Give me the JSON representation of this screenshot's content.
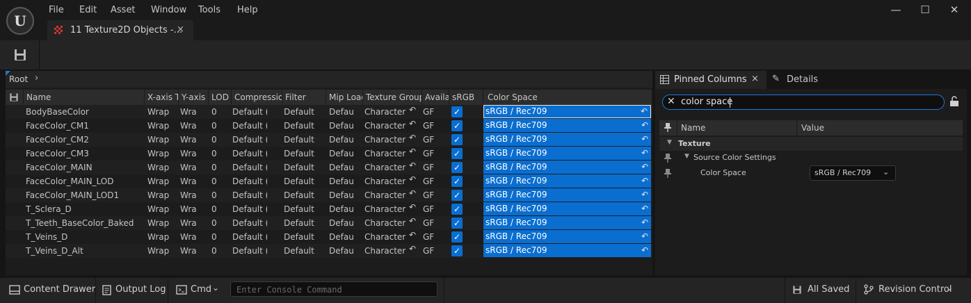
{
  "menu": [
    "File",
    "Edit",
    "Asset",
    "Window",
    "Tools",
    "Help"
  ],
  "tab": {
    "label": "11 Texture2D Objects -...",
    "close": "×"
  },
  "window_controls": {
    "minimize": "—",
    "maximize": "☐",
    "close": "✕"
  },
  "breadcrumb": {
    "root": "Root",
    "chevron": "›"
  },
  "columns": [
    "Name",
    "X-axis T",
    "Y-axis",
    "LOD",
    "Compression",
    "Filter",
    "Mip Load",
    "Texture Group",
    "Availa",
    "sRGB",
    "Color Space"
  ],
  "rows": [
    {
      "name": "BodyBaseColor",
      "x": "Wrap",
      "y": "Wra",
      "lod": "0",
      "compression": "Default (E",
      "filter": "Default",
      "mip": "Defau",
      "group": "Character",
      "avail": "GF",
      "srgb": true,
      "color_space": "sRGB / Rec709"
    },
    {
      "name": "FaceColor_CM1",
      "x": "Wrap",
      "y": "Wra",
      "lod": "0",
      "compression": "Default (E",
      "filter": "Default",
      "mip": "Defau",
      "group": "Character",
      "avail": "GF",
      "srgb": true,
      "color_space": "sRGB / Rec709"
    },
    {
      "name": "FaceColor_CM2",
      "x": "Wrap",
      "y": "Wra",
      "lod": "0",
      "compression": "Default (E",
      "filter": "Default",
      "mip": "Defau",
      "group": "Character",
      "avail": "GF",
      "srgb": true,
      "color_space": "sRGB / Rec709"
    },
    {
      "name": "FaceColor_CM3",
      "x": "Wrap",
      "y": "Wra",
      "lod": "0",
      "compression": "Default (E",
      "filter": "Default",
      "mip": "Defau",
      "group": "Character",
      "avail": "GF",
      "srgb": true,
      "color_space": "sRGB / Rec709"
    },
    {
      "name": "FaceColor_MAIN",
      "x": "Wrap",
      "y": "Wra",
      "lod": "0",
      "compression": "Default (E",
      "filter": "Default",
      "mip": "Defau",
      "group": "Character",
      "avail": "GF",
      "srgb": true,
      "color_space": "sRGB / Rec709"
    },
    {
      "name": "FaceColor_MAIN_LOD",
      "x": "Wrap",
      "y": "Wra",
      "lod": "0",
      "compression": "Default (E",
      "filter": "Default",
      "mip": "Defau",
      "group": "Character",
      "avail": "GF",
      "srgb": true,
      "color_space": "sRGB / Rec709"
    },
    {
      "name": "FaceColor_MAIN_LOD1",
      "x": "Wrap",
      "y": "Wra",
      "lod": "0",
      "compression": "Default (E",
      "filter": "Default",
      "mip": "Defau",
      "group": "Character",
      "avail": "GF",
      "srgb": true,
      "color_space": "sRGB / Rec709"
    },
    {
      "name": "T_Sclera_D",
      "x": "Wrap",
      "y": "Wra",
      "lod": "0",
      "compression": "Default (E",
      "filter": "Default",
      "mip": "Defau",
      "group": "Character",
      "avail": "GF",
      "srgb": true,
      "color_space": "sRGB / Rec709"
    },
    {
      "name": "T_Teeth_BaseColor_Baked",
      "x": "Wrap",
      "y": "Wra",
      "lod": "0",
      "compression": "Default (E",
      "filter": "Default",
      "mip": "Defau",
      "group": "Character",
      "avail": "GF",
      "srgb": true,
      "color_space": "sRGB / Rec709"
    },
    {
      "name": "T_Veins_D",
      "x": "Wrap",
      "y": "Wra",
      "lod": "0",
      "compression": "Default (E",
      "filter": "Default",
      "mip": "Defau",
      "group": "Character",
      "avail": "GF",
      "srgb": true,
      "color_space": "sRGB / Rec709"
    },
    {
      "name": "T_Veins_D_Alt",
      "x": "Wrap",
      "y": "Wra",
      "lod": "0",
      "compression": "Default (E",
      "filter": "Default",
      "mip": "Defau",
      "group": "Character",
      "avail": "GF",
      "srgb": true,
      "color_space": "sRGB / Rec709"
    }
  ],
  "right_panel": {
    "tab_pinned": "Pinned Columns",
    "tab_details": "Details",
    "search_value": "color space",
    "col_name": "Name",
    "col_value": "Value",
    "category": "Texture",
    "subcategory": "Source Color Settings",
    "property": "Color Space",
    "property_value": "sRGB / Rec709"
  },
  "bottom": {
    "content_drawer": "Content Drawer",
    "output_log": "Output Log",
    "cmd": "Cmd",
    "console_placeholder": "Enter Console Command",
    "all_saved": "All Saved",
    "revision_control": "Revision Control"
  },
  "colors": {
    "accent": "#0a6ed1",
    "bg": "#151515",
    "panel": "#1c1c1c"
  }
}
